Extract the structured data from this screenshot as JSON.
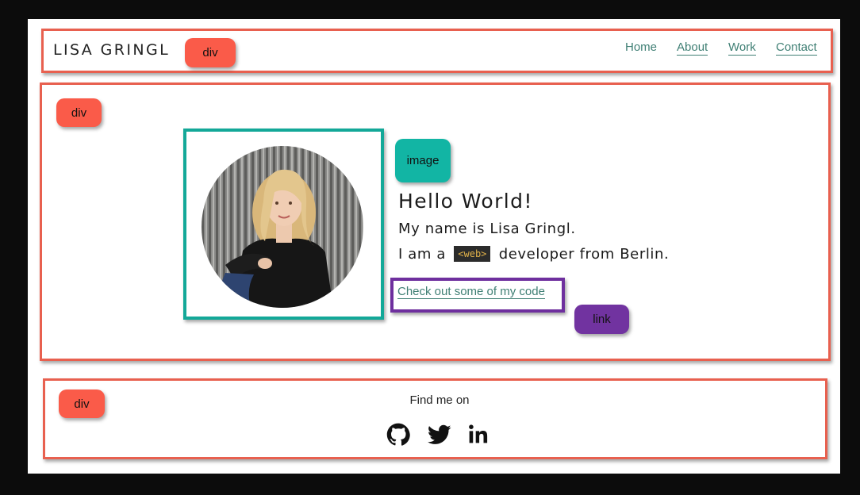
{
  "header": {
    "logo": "LISA GRINGL",
    "nav": [
      "Home",
      "About",
      "Work",
      "Contact"
    ]
  },
  "annotations": {
    "header_tag": "div",
    "main_tag": "div",
    "image_tag": "image",
    "link_tag": "link",
    "footer_tag": "div"
  },
  "hero": {
    "title": "Hello World!",
    "intro": "My name is Lisa Gringl.",
    "role_prefix": "I am a",
    "role_code": "<web>",
    "role_suffix": "developer from Berlin.",
    "cta": "Check out some of my code"
  },
  "footer": {
    "label": "Find me on",
    "icons": [
      "github-icon",
      "twitter-icon",
      "linkedin-icon"
    ]
  },
  "colors": {
    "annotation_red": "#fa5b49",
    "annotation_teal": "#12b5a4",
    "annotation_purple": "#7133a0",
    "link": "#3f7f74"
  }
}
